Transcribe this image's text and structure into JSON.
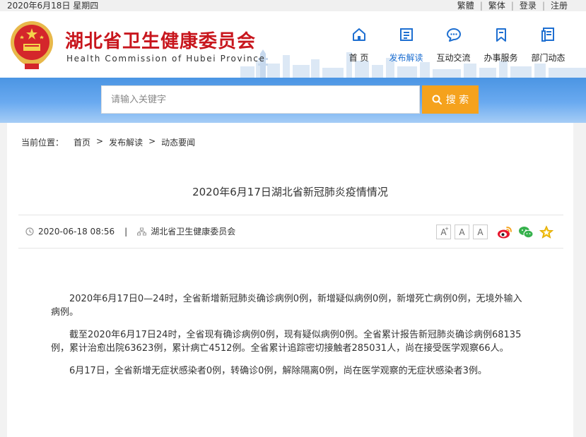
{
  "topbar": {
    "date": "2020年6月18日 星期四",
    "links": [
      "繁體",
      "繁体",
      "登录",
      "注册"
    ]
  },
  "header": {
    "title_cn": "湖北省卫生健康委员会",
    "title_en": "Health Commission of Hubei Province"
  },
  "nav": [
    {
      "label": "首  页",
      "icon": "home-icon"
    },
    {
      "label": "发布解读",
      "icon": "document-icon",
      "active": true
    },
    {
      "label": "互动交流",
      "icon": "chat-bubble-icon"
    },
    {
      "label": "办事服务",
      "icon": "bookmark-icon"
    },
    {
      "label": "部门动态",
      "icon": "news-icon"
    }
  ],
  "search": {
    "placeholder": "请输入关键字",
    "button_label": "搜 索"
  },
  "breadcrumb": {
    "prefix": "当前位置：",
    "items": [
      "首页",
      "发布解读",
      "动态要闻"
    ],
    "separator": ">"
  },
  "article": {
    "title": "2020年6月17日湖北省新冠肺炎疫情情况",
    "date": "2020-06-18 08:56",
    "source": "湖北省卫生健康委员会",
    "paragraphs": [
      "2020年6月17日0—24时，全省新增新冠肺炎确诊病例0例，新增疑似病例0例，新增死亡病例0例，无境外输入病例。",
      "截至2020年6月17日24时，全省现有确诊病例0例，现有疑似病例0例。全省累计报告新冠肺炎确诊病例68135例，累计治愈出院63623例，累计病亡4512例。全省累计追踪密切接触者285031人，尚在接受医学观察66人。",
      "6月17日，全省新增无症状感染者0例，转确诊0例，解除隔离0例，尚在医学观察的无症状感染者3例。"
    ]
  },
  "font_controls": [
    "A",
    "A",
    "A"
  ],
  "colors": {
    "brand_red": "#c8161d",
    "nav_blue": "#1e6fd1",
    "search_orange": "#f5a21d"
  }
}
